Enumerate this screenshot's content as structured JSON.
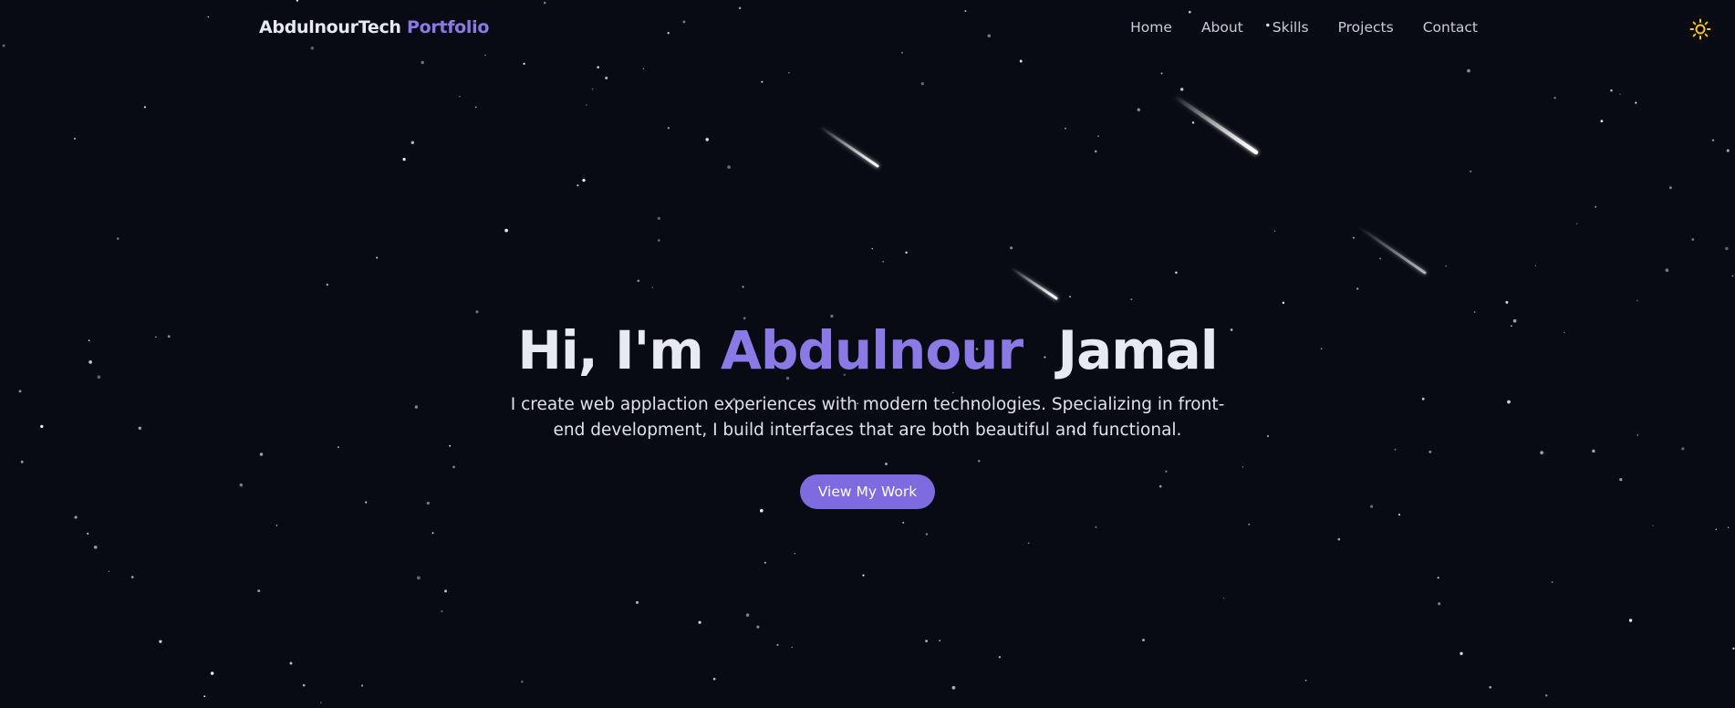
{
  "header": {
    "brand_main": "AbdulnourTech",
    "brand_accent": "Portfolio",
    "nav": [
      "Home",
      "About",
      "Skills",
      "Projects",
      "Contact"
    ],
    "theme_toggle_icon": "sun-icon"
  },
  "hero": {
    "greeting": "Hi, I'm",
    "first_name": "Abdulnour",
    "last_name": "Jamal",
    "description": "I create web applaction experiences with modern technologies. Specializing in front-end development, I build interfaces that are both beautiful and functional.",
    "cta_label": "View My Work"
  },
  "colors": {
    "background": "#080b14",
    "accent": "#8b79e6",
    "button": "#7f6be0",
    "sun_icon": "#f5c518"
  }
}
